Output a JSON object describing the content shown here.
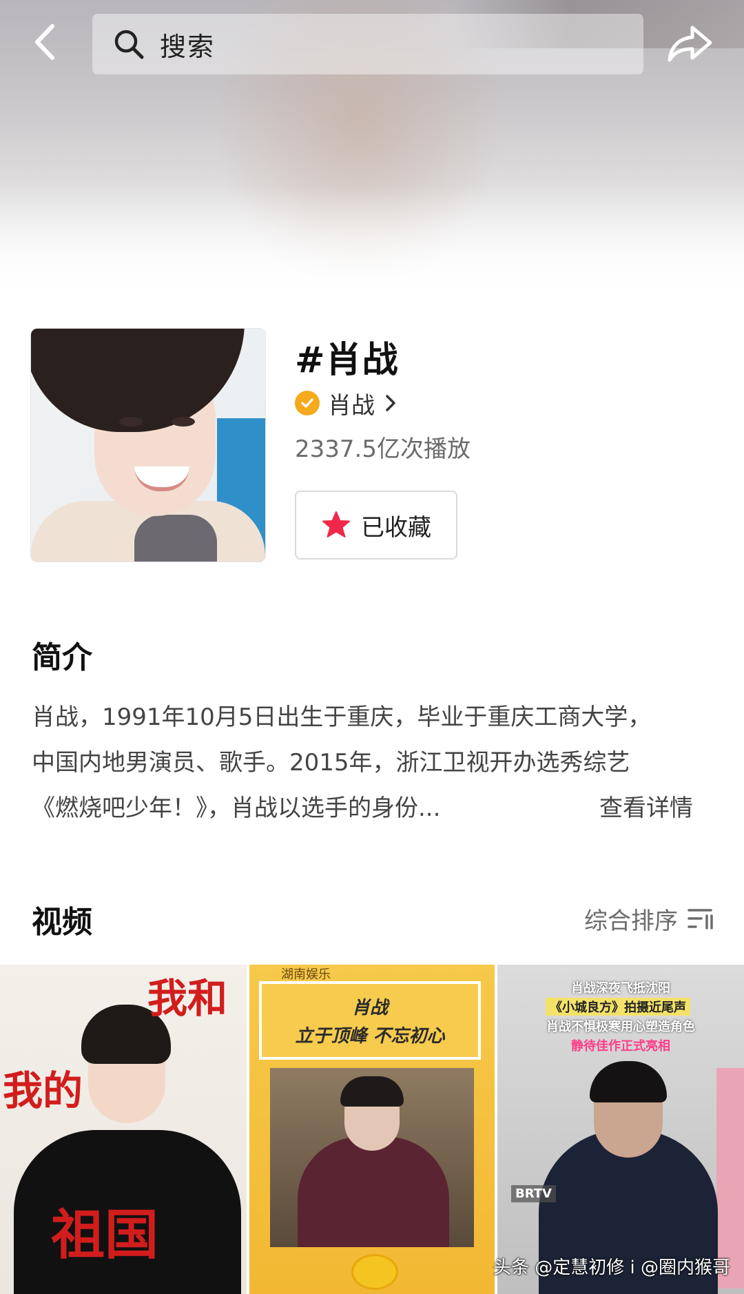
{
  "topbar": {
    "search_placeholder": "搜索"
  },
  "topic": {
    "title": "#肖战",
    "creator_name": "肖战",
    "play_count": "2337.5亿次播放",
    "favorite_label": "已收藏"
  },
  "intro": {
    "title": "简介",
    "lines": [
      "肖战，1991年10月5日出生于重庆，毕业于重庆工商大学，",
      "中国内地男演员、歌手。2015年，浙江卫视开办选秀综艺",
      "《燃烧吧少年！》，肖战以选手的身份..."
    ],
    "see_more": "查看详情"
  },
  "videos": {
    "title": "视频",
    "sort_label": "综合排序",
    "cards": [
      {
        "overlay_texts": [
          "我和",
          "我的",
          "祖国"
        ]
      },
      {
        "logo": "湖南娱乐",
        "headline": "肖战",
        "subheadline": "立于顶峰 不忘初心"
      },
      {
        "caption_lines": [
          "肖战深夜飞抵沈阳",
          "《小城良方》拍摄近尾声",
          "肖战不惧极寒用心塑造角色",
          "静待佳作正式亮相"
        ],
        "tag": "BRTV"
      }
    ]
  },
  "watermark": "头条 @定慧初修 i @圈内猴哥",
  "colors": {
    "verified_badge": "#f5a91c",
    "favorite_star": "#f0284a",
    "text_primary": "#111111",
    "text_secondary": "#6b6b6b"
  },
  "icons": {
    "back": "chevron-left-icon",
    "search": "search-icon",
    "share": "share-arrow-icon",
    "verified": "verified-check-icon",
    "favorite": "star-icon",
    "sort": "sort-filter-icon"
  }
}
